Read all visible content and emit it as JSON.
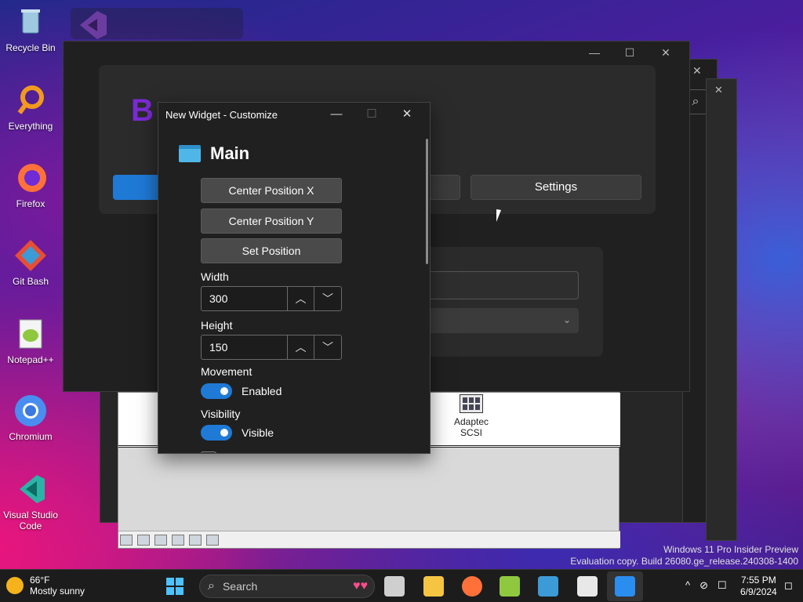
{
  "desktop": {
    "icons": [
      {
        "label": "Recycle Bin",
        "icon": "recycle-bin-icon"
      },
      {
        "label": "Everything",
        "icon": "everything-icon"
      },
      {
        "label": "Firefox",
        "icon": "firefox-icon"
      },
      {
        "label": "Git Bash",
        "icon": "git-bash-icon"
      },
      {
        "label": "Notepad++",
        "icon": "notepad-plus-plus-icon"
      },
      {
        "label": "Chromium",
        "icon": "chromium-icon"
      },
      {
        "label": "Visual Studio Code",
        "icon": "vscode-icon"
      }
    ]
  },
  "main_window": {
    "title_prefix": "B",
    "settings_button": "Settings",
    "controls": {
      "minimize": "—",
      "maximize": "☐",
      "close": "✕"
    }
  },
  "legacy_window": {
    "item_label": "Adaptec SCSI"
  },
  "dialog": {
    "title": "New Widget - Customize",
    "section_title": "Main",
    "buttons": {
      "center_x": "Center Position X",
      "center_y": "Center Position Y",
      "set_position": "Set Position"
    },
    "width": {
      "label": "Width",
      "value": "300"
    },
    "height": {
      "label": "Height",
      "value": "150"
    },
    "movement": {
      "label": "Movement",
      "state": "Enabled",
      "on": true
    },
    "visibility": {
      "label": "Visibility",
      "state": "Visible",
      "on": true
    },
    "controls": {
      "minimize": "—",
      "maximize": "☐",
      "close": "✕"
    },
    "spin_up": "︿",
    "spin_down": "﹀"
  },
  "watermark": {
    "line1": "Windows 11 Pro Insider Preview",
    "line2": "Evaluation copy. Build 26080.ge_release.240308-1400"
  },
  "taskbar": {
    "weather_temp": "66°F",
    "weather_desc": "Mostly sunny",
    "search_placeholder": "Search",
    "time": "7:55 PM",
    "date": "6/9/2024",
    "tray_up": "^"
  },
  "colors": {
    "accent": "#1f7ad6",
    "title_purple": "#7b2ad6"
  }
}
